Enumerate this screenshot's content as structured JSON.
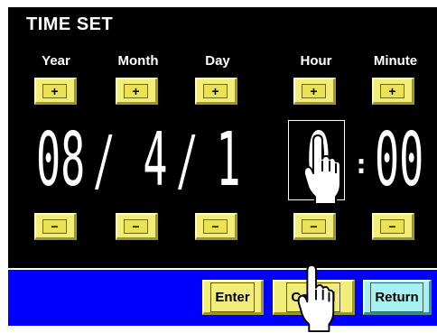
{
  "title": "TIME SET",
  "fields": [
    {
      "label": "Year",
      "value": "08"
    },
    {
      "label": "Month",
      "value": "4"
    },
    {
      "label": "Day",
      "value": "1"
    },
    {
      "label": "Hour",
      "value": "0"
    },
    {
      "label": "Minute",
      "value": "00"
    }
  ],
  "separators": {
    "date": "/",
    "time": ":"
  },
  "increment_label": "+",
  "decrement_label": "−",
  "buttons": {
    "enter": "Enter",
    "cancel": "Cancel",
    "return": "Return"
  },
  "selected_field": "Hour",
  "colors": {
    "screen_bg": "#000000",
    "action_bar": "#0000ff",
    "key_yellow": "#f2ec7a",
    "return_cyan": "#a6f2f2",
    "text": "#ffffff"
  },
  "icons": {
    "pointer": "hand-pointer-icon"
  }
}
